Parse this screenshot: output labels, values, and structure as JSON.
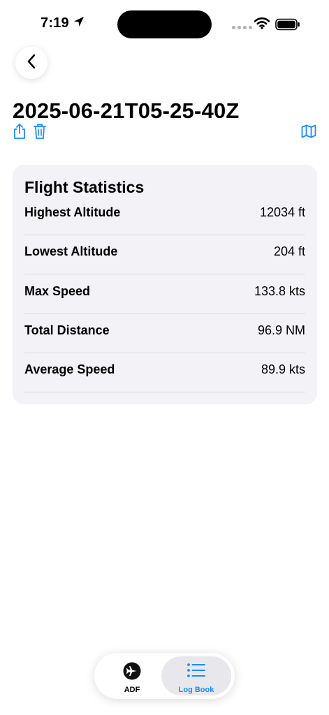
{
  "status_bar": {
    "time": "7:19",
    "icons": [
      "location-arrow-icon",
      "signal-dots-icon",
      "wifi-icon",
      "battery-icon"
    ]
  },
  "navigation": {
    "back_icon": "chevron-left-icon"
  },
  "page": {
    "title": "2025-06-21T05-25-40Z"
  },
  "actions": {
    "share_icon": "share-icon",
    "delete_icon": "trash-icon",
    "map_icon": "map-icon"
  },
  "stats": {
    "title": "Flight Statistics",
    "rows": [
      {
        "label": "Highest Altitude",
        "value": "12034 ft"
      },
      {
        "label": "Lowest Altitude",
        "value": "204 ft"
      },
      {
        "label": "Max Speed",
        "value": "133.8 kts"
      },
      {
        "label": "Total Distance",
        "value": "96.9 NM"
      },
      {
        "label": "Average Speed",
        "value": "89.9 kts"
      }
    ]
  },
  "tab_bar": {
    "tabs": [
      {
        "label": "ADF",
        "icon": "airplane-icon",
        "selected": false
      },
      {
        "label": "Log Book",
        "icon": "list-icon",
        "selected": true
      }
    ]
  },
  "colors": {
    "accent": "#1a8cff",
    "card_background": "#f2f2f7"
  }
}
